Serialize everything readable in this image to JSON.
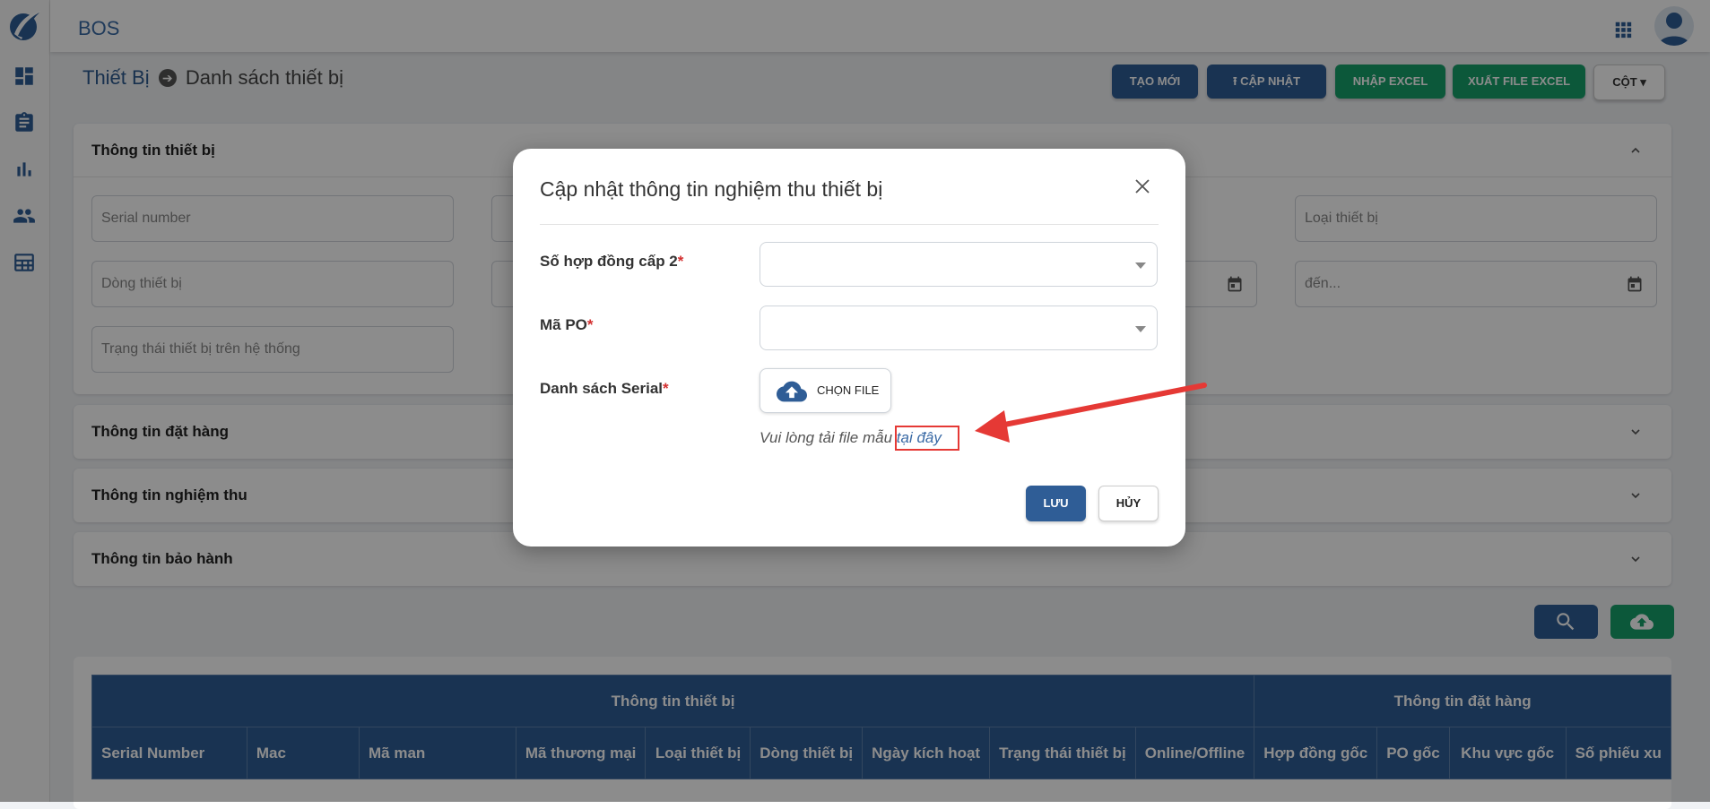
{
  "app": {
    "title": "BOS"
  },
  "sidebar": {
    "icons": [
      "dashboard-icon",
      "clipboard-icon",
      "bar-chart-icon",
      "people-icon",
      "table-icon"
    ]
  },
  "breadcrumb": {
    "parent": "Thiết Bị",
    "current": "Danh sách thiết bị"
  },
  "toolbar": {
    "create_label": "TẠO MỚI",
    "update_label": "CẬP NHẬT",
    "import_label": "NHẬP EXCEL",
    "export_label": "XUẤT FILE EXCEL",
    "columns_label": "CỘT"
  },
  "sections": {
    "device_info": "Thông tin thiết bị",
    "order_info": "Thông tin đặt hàng",
    "acceptance_info": "Thông tin nghiệm thu",
    "warranty_info": "Thông tin bảo hành"
  },
  "filters": {
    "serial_placeholder": "Serial number",
    "device_type_placeholder": "Loại thiết bị",
    "device_line_placeholder": "Dòng thiết bị",
    "date_to_placeholder": "đến...",
    "system_status_placeholder": "Trạng thái thiết bị trên hệ thống"
  },
  "table": {
    "group_headers": [
      "Thông tin thiết bị",
      "Thông tin đặt hàng"
    ],
    "columns": [
      "Serial Number",
      "Mac",
      "Mã man",
      "Mã thương mại",
      "Loại thiết bị",
      "Dòng thiết bị",
      "Ngày kích hoạt",
      "Trạng thái thiết bị",
      "Online/Offline",
      "Hợp đồng gốc",
      "PO gốc",
      "Khu vực gốc",
      "Số phiếu xu"
    ]
  },
  "modal": {
    "title": "Cập nhật thông tin nghiệm thu thiết bị",
    "contract_label": "Số hợp đồng cấp 2",
    "po_label": "Mã PO",
    "serial_list_label": "Danh sách Serial",
    "required_mark": "*",
    "choose_file_label": "CHỌN FILE",
    "hint_text": "Vui lòng tải file mẫu ",
    "hint_link": "tại đây",
    "save_label": "LƯU",
    "cancel_label": "HỦY"
  },
  "colors": {
    "primary": "#2f5d96",
    "success": "#16a06a",
    "annotation": "#e53935"
  }
}
